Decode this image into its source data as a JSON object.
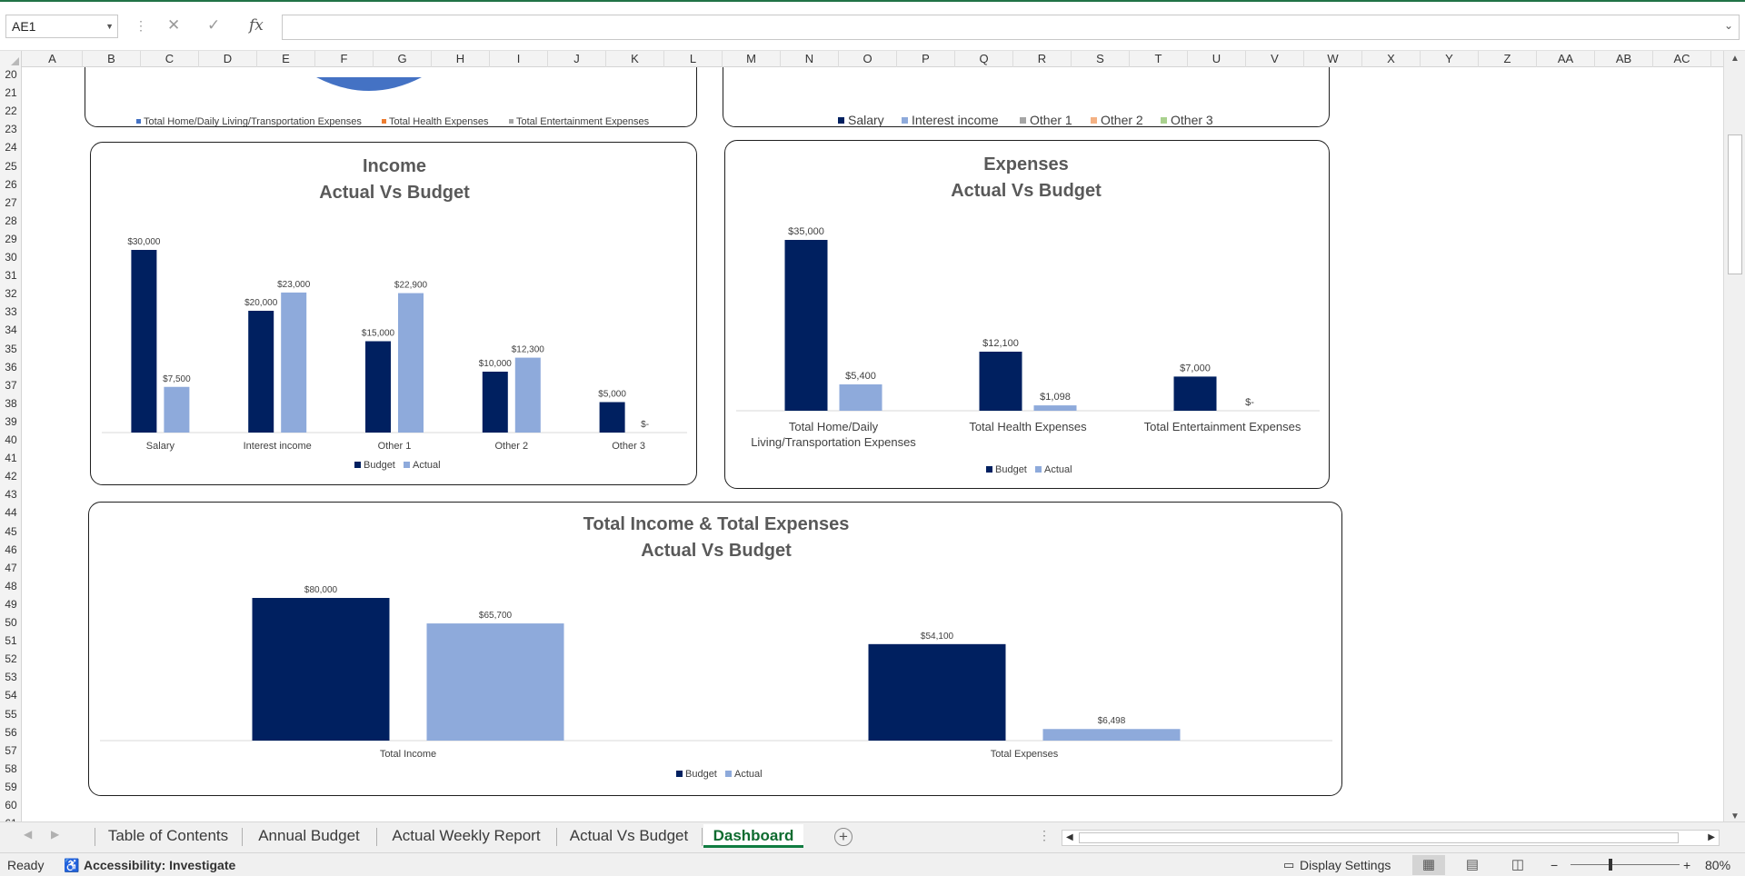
{
  "formula_bar": {
    "name_box": "AE1",
    "fx_label": "fx",
    "cancel_icon": "✕",
    "enter_icon": "✓",
    "formula": ""
  },
  "columns": [
    "A",
    "B",
    "C",
    "D",
    "E",
    "F",
    "G",
    "H",
    "I",
    "J",
    "K",
    "L",
    "M",
    "N",
    "O",
    "P",
    "Q",
    "R",
    "S",
    "T",
    "U",
    "V",
    "W",
    "X",
    "Y",
    "Z",
    "AA",
    "AB",
    "AC"
  ],
  "rows": [
    "20",
    "21",
    "22",
    "23",
    "24",
    "25",
    "26",
    "27",
    "28",
    "29",
    "30",
    "31",
    "32",
    "33",
    "34",
    "35",
    "36",
    "37",
    "38",
    "39",
    "40",
    "41",
    "42",
    "43",
    "44",
    "45",
    "46",
    "47",
    "48",
    "49",
    "50",
    "51",
    "52",
    "53",
    "54",
    "55",
    "56",
    "57",
    "58",
    "59",
    "60",
    "61"
  ],
  "top_left_legend": [
    "Total Home/Daily Living/Transportation Expenses",
    "Total Health Expenses",
    "Total Entertainment Expenses"
  ],
  "top_right_legend": [
    "Salary",
    "Interest income",
    "Other 1",
    "Other 2",
    "Other 3"
  ],
  "colors": {
    "budget": "#002060",
    "actual": "#8eaadb",
    "pie_blue": "#4472c4",
    "orange": "#ed7d31",
    "gray": "#a5a5a5",
    "peach": "#f4b183",
    "green": "#a9d18e",
    "excel_green": "#107c41"
  },
  "chart_data": [
    {
      "type": "bar",
      "title": "Income",
      "subtitle": "Actual Vs Budget",
      "categories": [
        "Salary",
        "Interest income",
        "Other 1",
        "Other 2",
        "Other 3"
      ],
      "series": [
        {
          "name": "Budget",
          "values": [
            30000,
            20000,
            15000,
            10000,
            5000
          ],
          "labels": [
            "$30,000",
            "$20,000",
            "$15,000",
            "$10,000",
            "$5,000"
          ]
        },
        {
          "name": "Actual",
          "values": [
            7500,
            23000,
            22900,
            12300,
            0
          ],
          "labels": [
            "$7,500",
            "$23,000",
            "$22,900",
            "$12,300",
            "$-"
          ]
        }
      ],
      "legend_position": "bottom",
      "grid": false
    },
    {
      "type": "bar",
      "title": "Expenses",
      "subtitle": "Actual Vs Budget",
      "categories": [
        [
          "Total Home/Daily",
          "Living/Transportation Expenses"
        ],
        [
          "Total Health Expenses"
        ],
        [
          "Total Entertainment Expenses"
        ]
      ],
      "series": [
        {
          "name": "Budget",
          "values": [
            35000,
            12100,
            7000
          ],
          "labels": [
            "$35,000",
            "$12,100",
            "$7,000"
          ]
        },
        {
          "name": "Actual",
          "values": [
            5400,
            1098,
            0
          ],
          "labels": [
            "$5,400",
            "$1,098",
            "$-"
          ]
        }
      ],
      "legend_position": "bottom",
      "grid": false
    },
    {
      "type": "bar",
      "title": "Total Income & Total Expenses",
      "subtitle": "Actual Vs Budget",
      "categories": [
        "Total Income",
        "Total Expenses"
      ],
      "series": [
        {
          "name": "Budget",
          "values": [
            80000,
            54100
          ],
          "labels": [
            "$80,000",
            "$54,100"
          ]
        },
        {
          "name": "Actual",
          "values": [
            65700,
            6498
          ],
          "labels": [
            "$65,700",
            "$6,498"
          ]
        }
      ],
      "legend_position": "bottom",
      "grid": false
    }
  ],
  "tabs": [
    "Table of Contents",
    "Annual Budget",
    "Actual Weekly Report",
    "Actual Vs Budget",
    "Dashboard"
  ],
  "active_tab": "Dashboard",
  "status": {
    "ready": "Ready",
    "accessibility": "Accessibility: Investigate",
    "display_settings": "Display Settings",
    "zoom": "80%"
  }
}
